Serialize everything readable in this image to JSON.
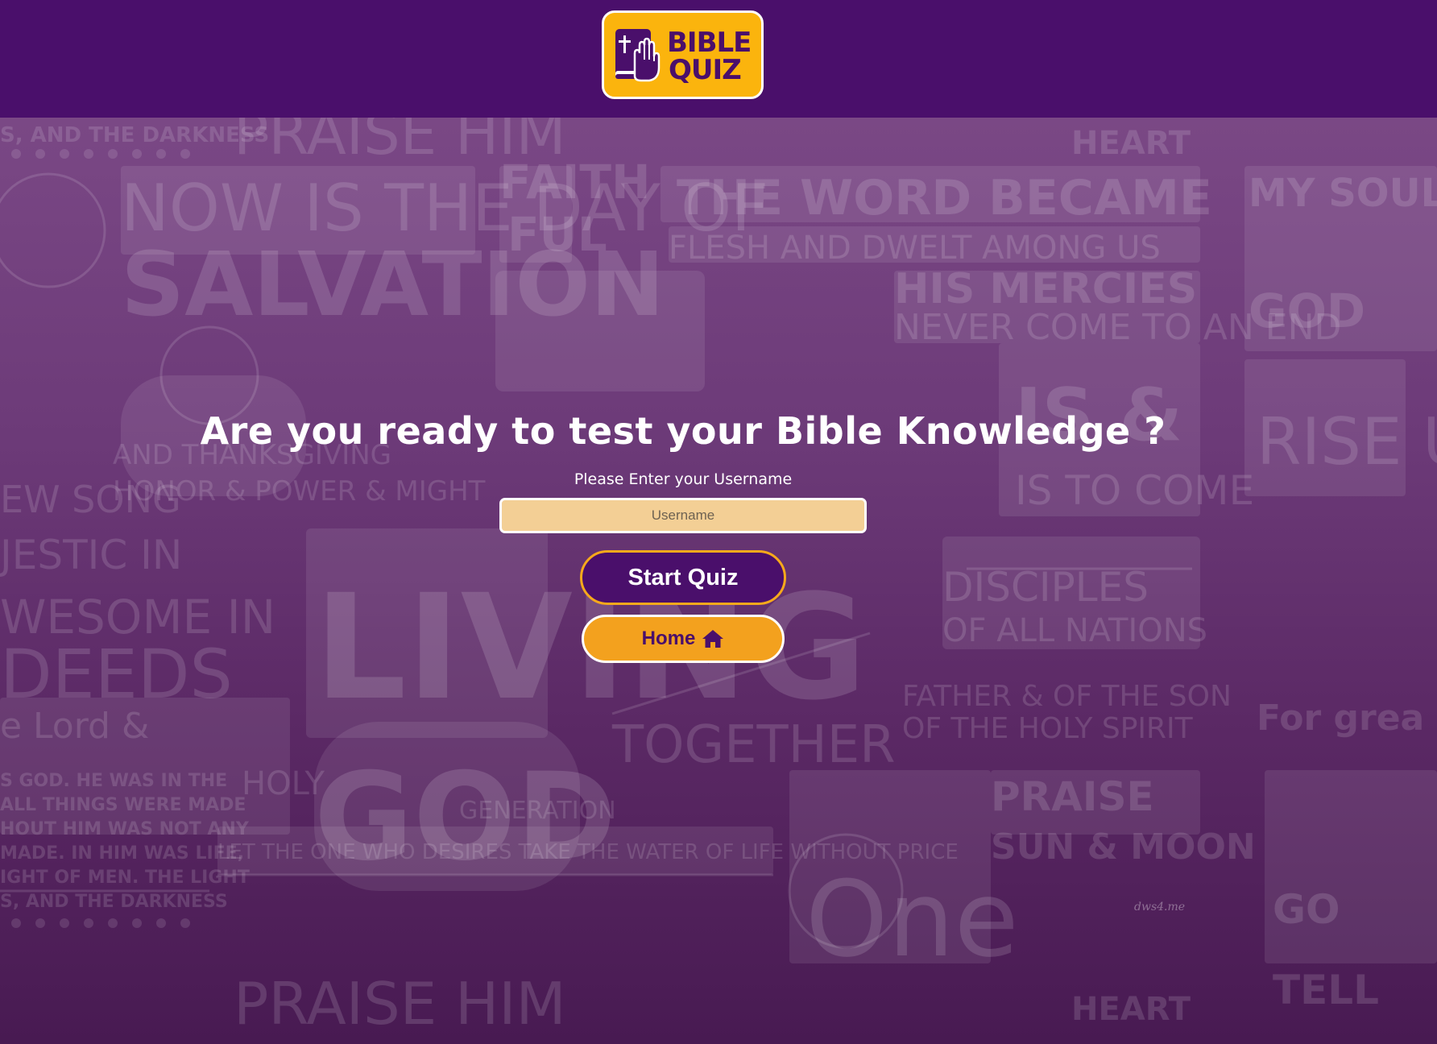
{
  "header": {
    "logo": {
      "line1": "BIBLE",
      "line2": "QUIZ"
    }
  },
  "main": {
    "headline": "Are you ready to test your Bible Knowledge ?",
    "prompt": "Please Enter your Username",
    "username": {
      "placeholder": "Username",
      "value": ""
    },
    "start_button": "Start Quiz",
    "home_button": "Home",
    "home_icon": "home-icon"
  },
  "background": {
    "watermark": "dws4.me"
  },
  "colors": {
    "header": "#4a0f6b",
    "logo_yellow": "#fbb40d",
    "start_button": "#4a0f6b",
    "start_border": "#f7a91b",
    "home_button": "#f3a11e",
    "input_bg": "#f3cf95"
  }
}
